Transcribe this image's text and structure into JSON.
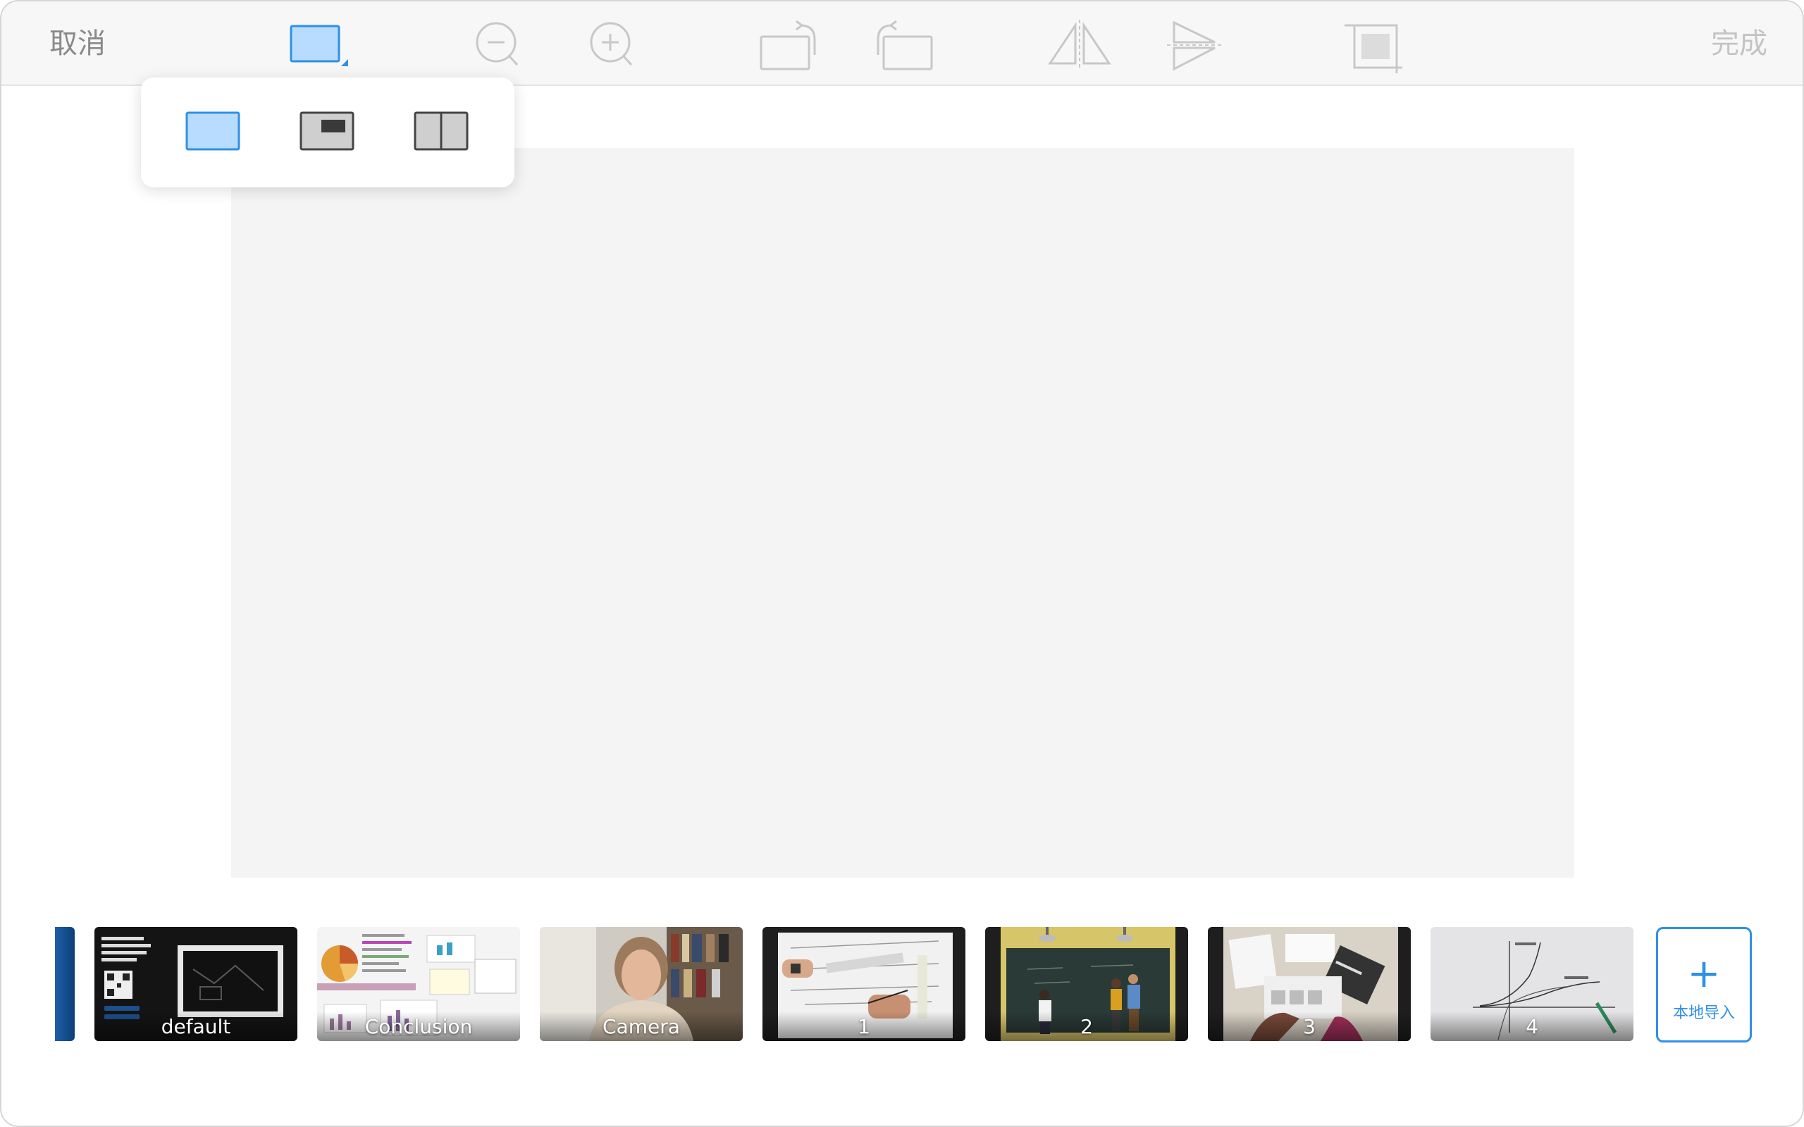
{
  "toolbar": {
    "cancel_label": "取消",
    "done_label": "完成",
    "tools": [
      {
        "name": "layout-mode-icon",
        "state": "active"
      },
      {
        "name": "zoom-out-icon"
      },
      {
        "name": "zoom-in-icon"
      },
      {
        "name": "rotate-left-icon"
      },
      {
        "name": "rotate-right-icon"
      },
      {
        "name": "flip-horizontal-icon"
      },
      {
        "name": "flip-vertical-icon"
      },
      {
        "name": "crop-icon"
      }
    ]
  },
  "layout_popup": {
    "options": [
      {
        "name": "full-screen",
        "selected": true
      },
      {
        "name": "picture-in-picture",
        "selected": false
      },
      {
        "name": "side-by-side",
        "selected": false
      }
    ]
  },
  "thumbnails": [
    {
      "label": "default"
    },
    {
      "label": "Conclusion"
    },
    {
      "label": "Camera"
    },
    {
      "label": "1"
    },
    {
      "label": "2"
    },
    {
      "label": "3"
    },
    {
      "label": "4"
    }
  ],
  "import_button": {
    "label": "本地导入",
    "icon": "plus-icon"
  },
  "colors": {
    "accent": "#2f90e6",
    "selection_fill": "#b7dcff",
    "toolbar_bg": "#f7f7f7",
    "canvas_bg": "#f4f4f4",
    "icon_disabled": "#c8c8c8",
    "text_muted": "#8a8a8a",
    "text_disabled": "#c4c4c4"
  }
}
